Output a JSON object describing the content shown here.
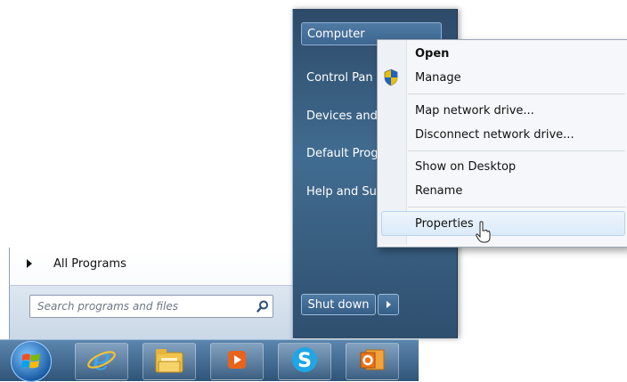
{
  "start_menu": {
    "all_programs": "All Programs",
    "search_placeholder": "Search programs and files",
    "right_items": [
      "Computer",
      "Control Pan",
      "Devices and",
      "Default Prog",
      "Help and Su"
    ],
    "shutdown": "Shut down"
  },
  "context_menu": {
    "items": [
      "Open",
      "Manage",
      "Map network drive...",
      "Disconnect network drive...",
      "Show on Desktop",
      "Rename",
      "Properties"
    ],
    "highlighted": "Properties"
  },
  "taskbar": {
    "icons": [
      "start-orb-icon",
      "internet-explorer-icon",
      "file-explorer-icon",
      "media-player-icon",
      "skype-icon",
      "outlook-icon"
    ]
  }
}
